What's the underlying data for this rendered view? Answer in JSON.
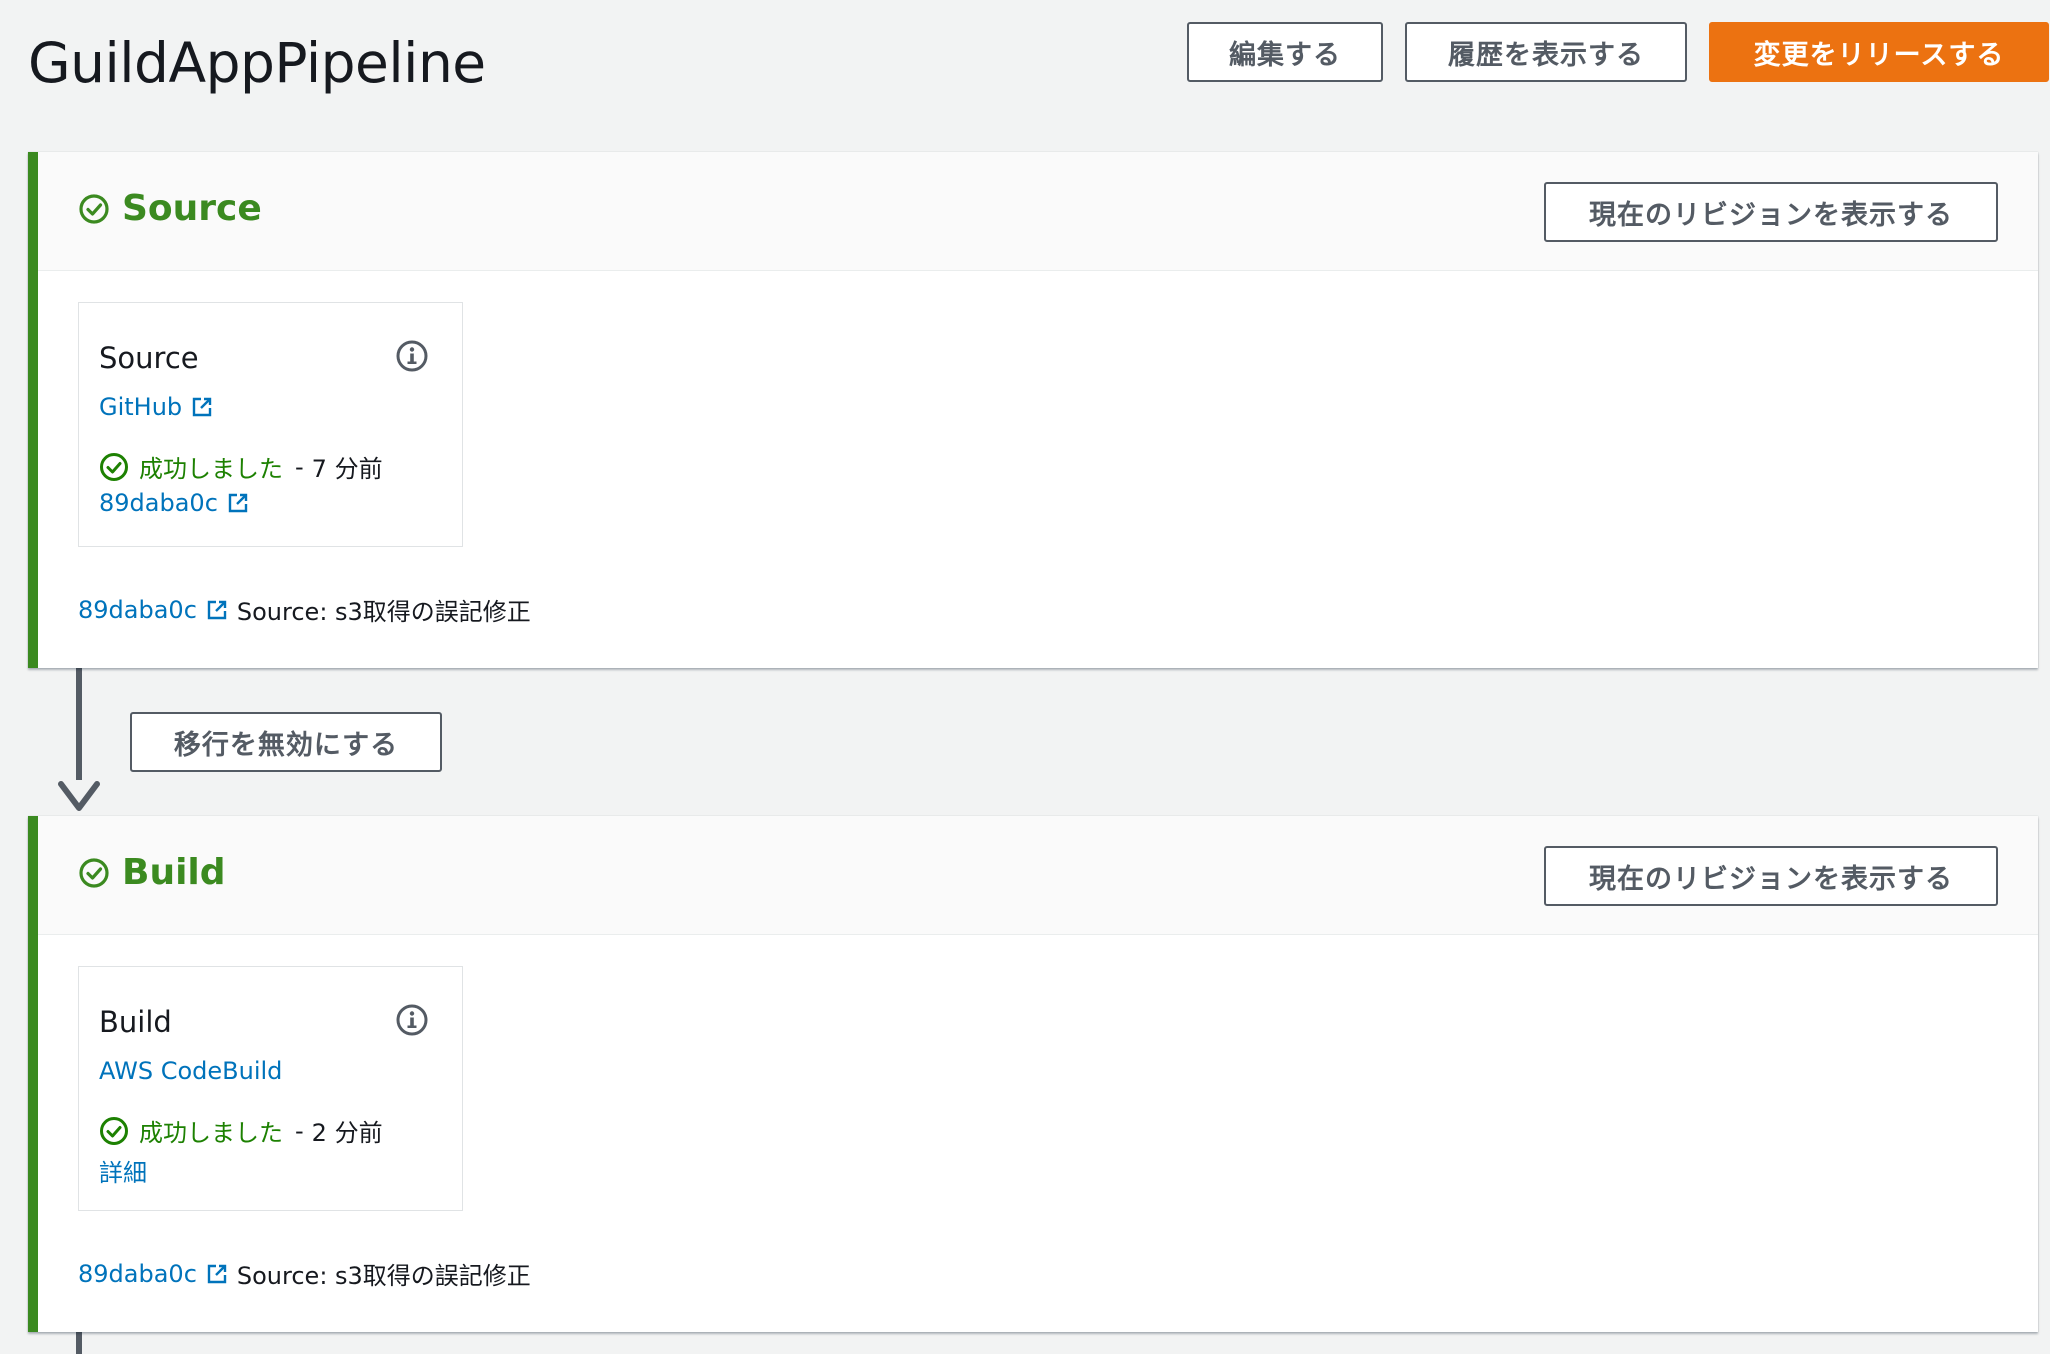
{
  "header": {
    "title": "GuildAppPipeline",
    "edit_label": "編集する",
    "history_label": "履歴を表示する",
    "release_label": "変更をリリースする"
  },
  "colors": {
    "accent": "#ec7211",
    "success": "#3b8a20",
    "link": "#0073bb",
    "border": "#545b64"
  },
  "stages": [
    {
      "title": "Source",
      "view_revision_label": "現在のリビジョンを表示する",
      "action": {
        "name": "Source",
        "provider": "GitHub",
        "provider_icon": "external-link-icon",
        "status": "成功しました",
        "separator": "-",
        "time": "7 分前",
        "sub_link": "89daba0c"
      },
      "commit": {
        "id": "89daba0c",
        "message": "Source: s3取得の誤記修正"
      }
    },
    {
      "title": "Build",
      "view_revision_label": "現在のリビジョンを表示する",
      "action": {
        "name": "Build",
        "provider": "AWS CodeBuild",
        "status": "成功しました",
        "separator": "-",
        "time": "2 分前",
        "sub_link": "詳細"
      },
      "commit": {
        "id": "89daba0c",
        "message": "Source: s3取得の誤記修正"
      }
    }
  ],
  "transition": {
    "disable_label": "移行を無効にする"
  }
}
